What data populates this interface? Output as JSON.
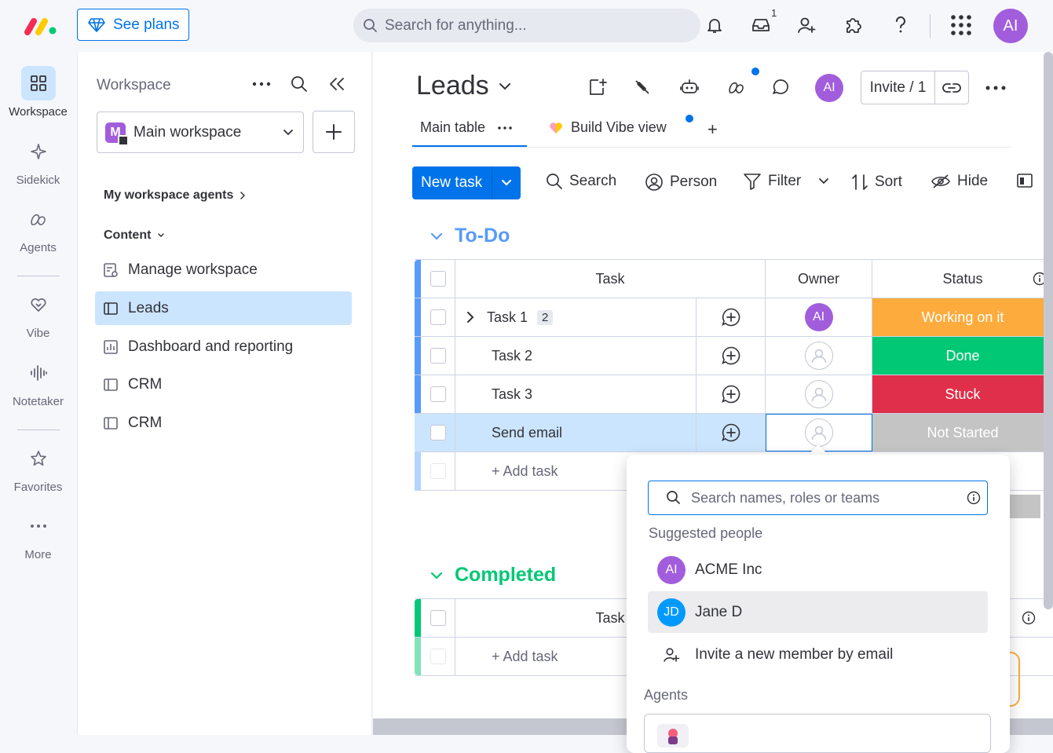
{
  "topbar": {
    "see_plans": "See plans",
    "search_placeholder": "Search for anything...",
    "inbox_count": "1",
    "user_initials": "AI"
  },
  "rail": {
    "items": [
      {
        "label": "Workspace",
        "icon": "grid-icon"
      },
      {
        "label": "Sidekick",
        "icon": "sparkle-icon"
      },
      {
        "label": "Agents",
        "icon": "agents-icon"
      },
      {
        "label": "Vibe",
        "icon": "heart-icon"
      },
      {
        "label": "Notetaker",
        "icon": "audio-wave-icon"
      },
      {
        "label": "Favorites",
        "icon": "star-icon"
      },
      {
        "label": "More",
        "icon": "more-dots-icon"
      }
    ]
  },
  "workspace": {
    "title": "Workspace",
    "selected": "Main workspace",
    "selected_initial": "M",
    "agents_section": "My workspace agents",
    "content_section": "Content",
    "items": [
      {
        "label": "Manage workspace"
      },
      {
        "label": "Leads"
      },
      {
        "label": "Dashboard and reporting"
      },
      {
        "label": "CRM"
      },
      {
        "label": "CRM"
      }
    ]
  },
  "board": {
    "title": "Leads",
    "invite": "Invite / 1",
    "avatar": "AI",
    "tabs": {
      "main": "Main table",
      "vibe": "Build Vibe view",
      "add": "+"
    },
    "toolbar": {
      "new_task": "New task",
      "search": "Search",
      "person": "Person",
      "filter": "Filter",
      "sort": "Sort",
      "hide": "Hide"
    }
  },
  "todo": {
    "title": "To-Do",
    "color": "#579bfc",
    "columns": {
      "task": "Task",
      "owner": "Owner",
      "status": "Status"
    },
    "rows": [
      {
        "task": "Task 1",
        "subitems": "2",
        "owner": "AI",
        "status": "Working on it",
        "status_color": "#fdab3d"
      },
      {
        "task": "Task 2",
        "owner": "",
        "status": "Done",
        "status_color": "#00c875"
      },
      {
        "task": "Task 3",
        "owner": "",
        "status": "Stuck",
        "status_color": "#df2f4a"
      },
      {
        "task": "Send email",
        "owner": "",
        "status": "Not Started",
        "status_color": "#c4c4c4"
      }
    ],
    "add_task": "+ Add task"
  },
  "completed": {
    "title": "Completed",
    "color": "#00c875",
    "columns": {
      "task": "Task"
    },
    "add_task": "+ Add task"
  },
  "popup": {
    "search_placeholder": "Search names, roles or teams",
    "suggested_label": "Suggested people",
    "people": [
      {
        "initials": "AI",
        "name": "ACME Inc",
        "color": "#a25ddc"
      },
      {
        "initials": "JD",
        "name": "Jane D",
        "color": "#009aff"
      }
    ],
    "invite": "Invite a new member by email",
    "agents_label": "Agents"
  }
}
